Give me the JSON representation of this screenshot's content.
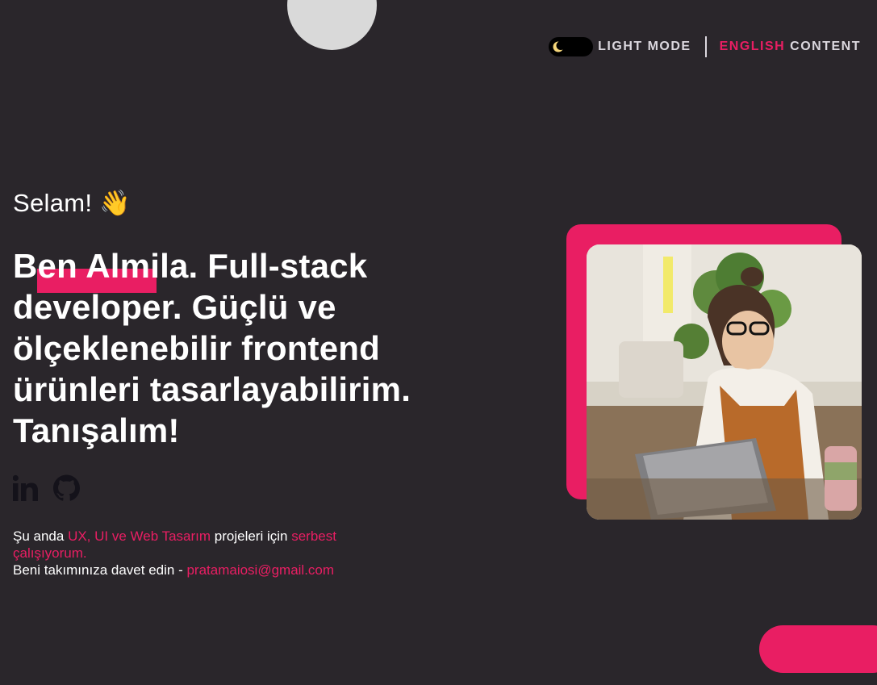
{
  "header": {
    "mode_label": "LIGHT MODE",
    "lang_accent": "ENGLISH",
    "lang_rest": " CONTENT",
    "moon_icon": "crescent-moon-icon"
  },
  "hero": {
    "greeting": "Selam! 👋",
    "headline": "Ben Almila. Full-stack developer. Güçlü ve ölçeklenebilir frontend ürünleri tasarlayabilirim. Tanışalım!"
  },
  "socials": [
    {
      "name": "LinkedIn",
      "icon": "linkedin-icon"
    },
    {
      "name": "GitHub",
      "icon": "github-icon"
    }
  ],
  "about": {
    "line1_prefix": "Şu anda ",
    "line1_accent1": "UX, UI ve Web Tasarım",
    "line1_mid": " projeleri için ",
    "line1_accent2": "serbest çalışıyorum.",
    "line2_prefix": "Beni takımınıza davet edin - ",
    "email": "pratamaiosi@gmail.com"
  },
  "colors": {
    "background": "#2a262b",
    "accent": "#e91e63",
    "text": "#ffffff"
  }
}
